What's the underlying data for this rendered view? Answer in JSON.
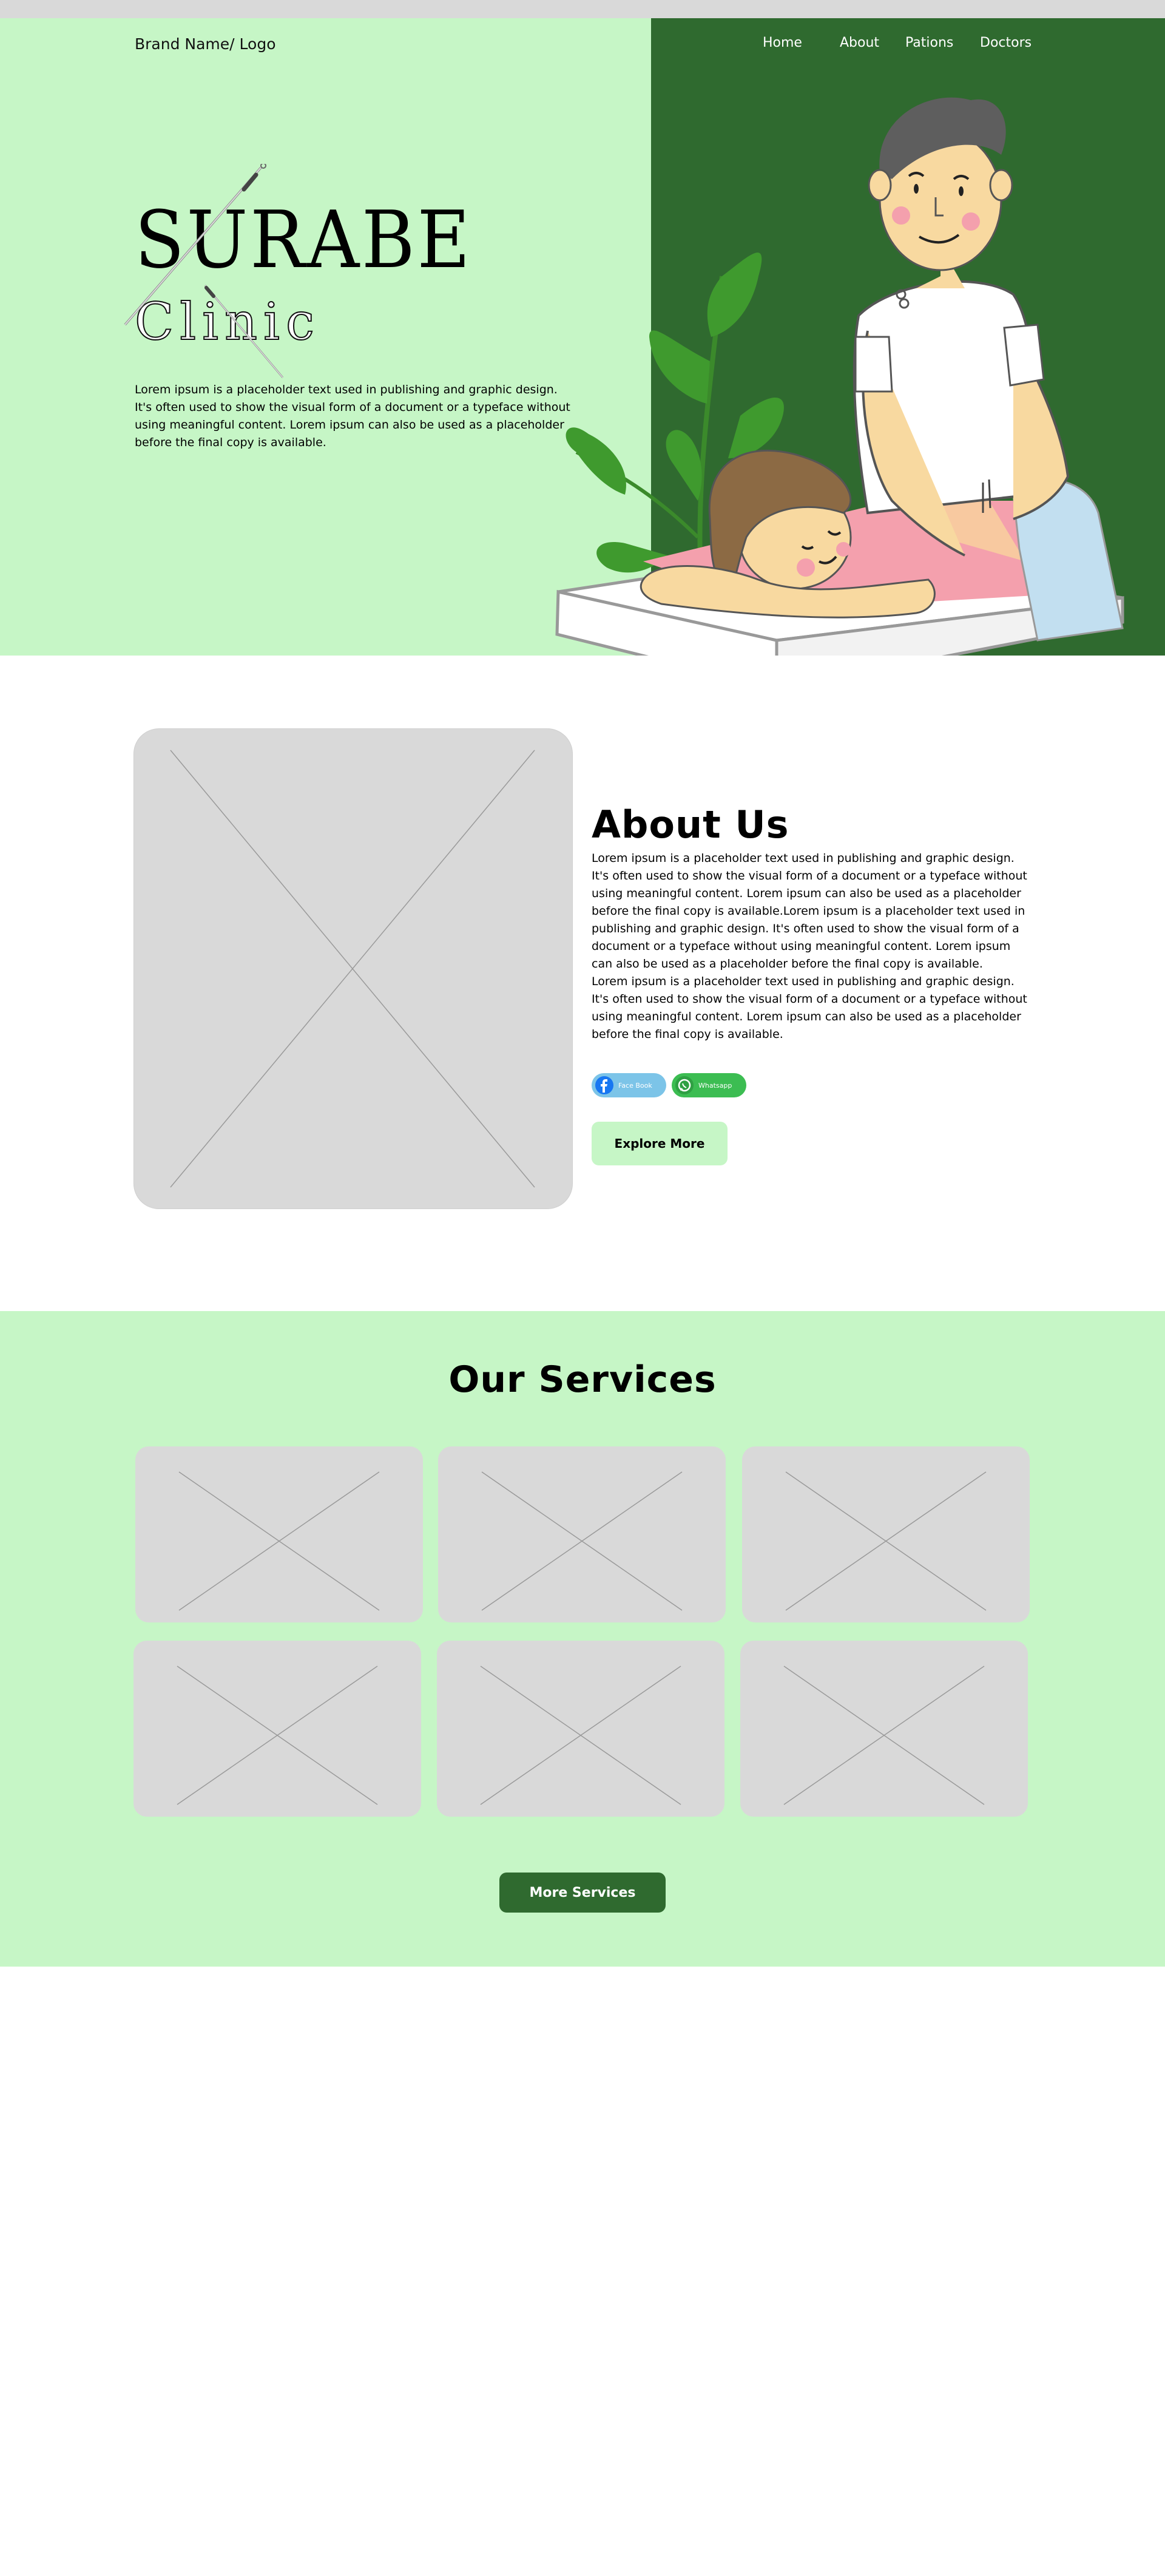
{
  "header": {
    "brand": "Brand Name/ Logo",
    "nav": [
      "Home",
      "About",
      "Pations",
      "Doctors"
    ]
  },
  "hero": {
    "title": "SURABE",
    "subtitle": "Clinic",
    "text": "Lorem ipsum is a placeholder text used in publishing and graphic design. It's often used to show the visual form of a document or a typeface without using meaningful content. Lorem ipsum can also be used as a placeholder before the final copy is available."
  },
  "about": {
    "title": "About Us",
    "paragraphs": [
      "Lorem ipsum is a placeholder text used in publishing and graphic design. It's often used to show the visual form of a document or a typeface without using meaningful content. Lorem ipsum can also be used as a placeholder before the final copy is available.Lorem ipsum is a placeholder text used in publishing and graphic design. It's often used to show the visual form of a document or a typeface without using meaningful content. Lorem ipsum can also be used as a placeholder before the final copy is available.",
      "Lorem ipsum is a placeholder text used in publishing and graphic design. It's often used to show the visual form of a document or a typeface without using meaningful content. Lorem ipsum can also be used as a placeholder before the final copy is available."
    ],
    "facebook_label": "Face Book",
    "whatsapp_label": "Whatsapp",
    "explore_label": "Explore More"
  },
  "services": {
    "title": "Our Services",
    "more_label": "More Services"
  },
  "colors": {
    "light_green": "#c6f6c6",
    "dark_green": "#2f6a2f",
    "placeholder_gray": "#d9d9d9"
  }
}
